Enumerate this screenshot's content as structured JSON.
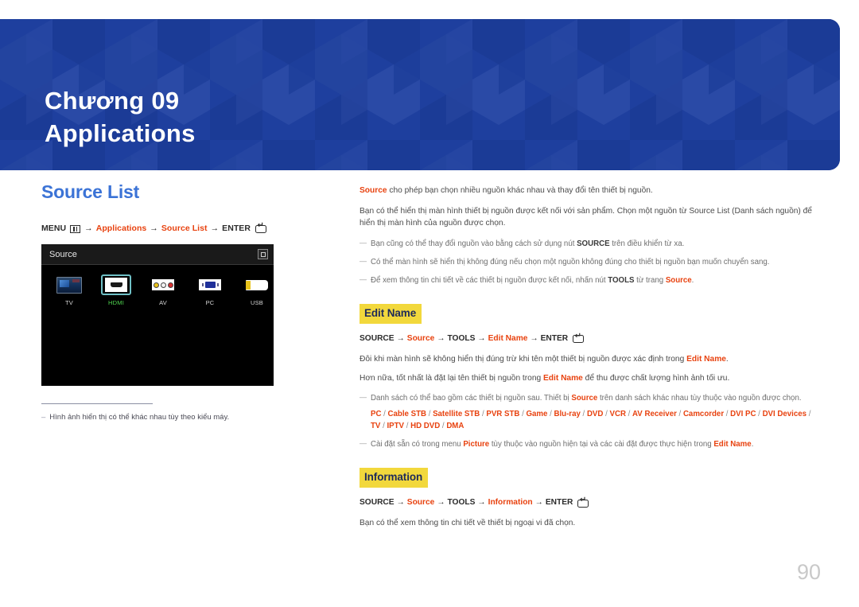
{
  "banner": {
    "chapter": "Chương 09",
    "title": "Applications",
    "bg_color": "#1e3f9e"
  },
  "left": {
    "section_title": "Source List",
    "menu_path": {
      "menu_label": "MENU",
      "menu_icon": "menu-grid-icon",
      "arrow": "→",
      "item1": "Applications",
      "item2": "Source List",
      "enter_label": "ENTER",
      "enter_icon": "enter-key-icon"
    },
    "tv_panel": {
      "header_title": "Source",
      "corner_icon": "window-restore-icon",
      "sources": [
        {
          "label": "TV",
          "icon": "tv-icon",
          "selected": false
        },
        {
          "label": "HDMI",
          "icon": "hdmi-port-icon",
          "selected": true
        },
        {
          "label": "AV",
          "icon": "av-rca-jacks-icon",
          "selected": false
        },
        {
          "label": "PC",
          "icon": "vga-port-icon",
          "selected": false
        },
        {
          "label": "USB",
          "icon": "usb-drive-icon",
          "selected": false
        }
      ]
    },
    "note": {
      "dash": "–",
      "text": "Hình ảnh hiển thị có thể khác nhau tùy theo kiểu máy."
    }
  },
  "right": {
    "intro": {
      "term": "Source",
      "rest": " cho phép bạn chọn nhiều nguồn khác nhau và thay đổi tên thiết bị nguồn."
    },
    "paragraph1": "Bạn có thể hiển thị màn hình thiết bị nguồn được kết nối với sản phẩm. Chọn một nguồn từ Source List (Danh sách nguồn) để hiển thị màn hình của nguồn được chọn.",
    "notes_top": [
      {
        "dash": "—",
        "pre": "Bạn cũng có thể thay đổi nguồn vào bằng cách sử dụng nút ",
        "bold": "SOURCE",
        "post": " trên điều khiển từ xa."
      },
      {
        "dash": "—",
        "pre": "Có thể màn hình sẽ hiển thị không đúng nếu chọn một nguồn không đúng cho thiết bị nguồn bạn muốn chuyển sang.",
        "bold": "",
        "post": ""
      },
      {
        "dash": "—",
        "pre": "Để xem thông tin chi tiết về các thiết bị nguồn được kết nối, nhấn nút ",
        "bold": "TOOLS",
        "post": " từ trang ",
        "red": "Source",
        "tail": "."
      }
    ],
    "edit_name": {
      "heading": "Edit Name",
      "path": {
        "source_btn": "SOURCE",
        "arrow": "→",
        "source_item": "Source",
        "tools": "TOOLS",
        "item": "Edit Name",
        "enter_label": "ENTER",
        "enter_icon": "enter-key-icon"
      },
      "para1_pre": "Đôi khi màn hình sẽ không hiển thị đúng trừ khi tên một thiết bị nguồn được xác định trong ",
      "para1_red": "Edit Name",
      "para1_post": ".",
      "para2_pre": "Hơn nữa, tốt nhất là đặt lại tên thiết bị nguồn trong ",
      "para2_red": "Edit Name",
      "para2_post": " để thu được chất lượng hình ảnh tối ưu.",
      "note1": {
        "dash": "—",
        "pre": "Danh sách có thể bao gồm các thiết bị nguồn sau. Thiết bị ",
        "red": "Source",
        "post": " trên danh sách khác nhau tùy thuộc vào nguồn được chọn."
      },
      "device_list": [
        "PC",
        "Cable STB",
        "Satellite STB",
        "PVR STB",
        "Game",
        "Blu-ray",
        "DVD",
        "VCR",
        "AV Receiver",
        "Camcorder",
        "DVI PC",
        "DVI Devices",
        "TV",
        "IPTV",
        "HD DVD",
        "DMA"
      ],
      "device_separator": "/",
      "note2": {
        "dash": "—",
        "pre": "Cài đặt sẵn có trong menu ",
        "bold": "Picture",
        "mid": " tùy thuộc vào nguồn hiện tại và các cài đặt được thực hiện trong ",
        "red": "Edit Name",
        "post": "."
      }
    },
    "information": {
      "heading": "Information",
      "path": {
        "source_btn": "SOURCE",
        "arrow": "→",
        "source_item": "Source",
        "tools": "TOOLS",
        "item": "Information",
        "enter_label": "ENTER",
        "enter_icon": "enter-key-icon"
      },
      "body": "Bạn có thể xem thông tin chi tiết về thiết bị ngoại vi đã chọn."
    }
  },
  "page_number": "90",
  "colors": {
    "accent_blue": "#3b73d6",
    "banner_blue": "#1e3f9e",
    "red": "#e8420f",
    "highlight_yellow": "#f2d83c",
    "highlight_text": "#1e2a5a",
    "selected_green": "#4fd44f"
  }
}
